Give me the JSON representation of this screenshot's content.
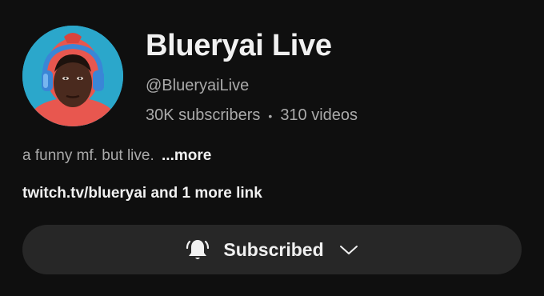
{
  "channel": {
    "name": "Blueryai Live",
    "handle": "@BlueryaiLive",
    "subscribers": "30K subscribers",
    "separator": "•",
    "videos": "310 videos",
    "description": "a funny mf. but live.",
    "more_label": "...more",
    "links_text": "twitch.tv/blueryai and 1 more link"
  },
  "subscribe_button": {
    "label": "Subscribed",
    "bell_icon": "bell-icon",
    "chevron_icon": "chevron-down-icon"
  },
  "colors": {
    "background": "#0f0f0f",
    "button_bg": "#272727",
    "primary_text": "#f1f1f1",
    "secondary_text": "#aaaaaa"
  }
}
